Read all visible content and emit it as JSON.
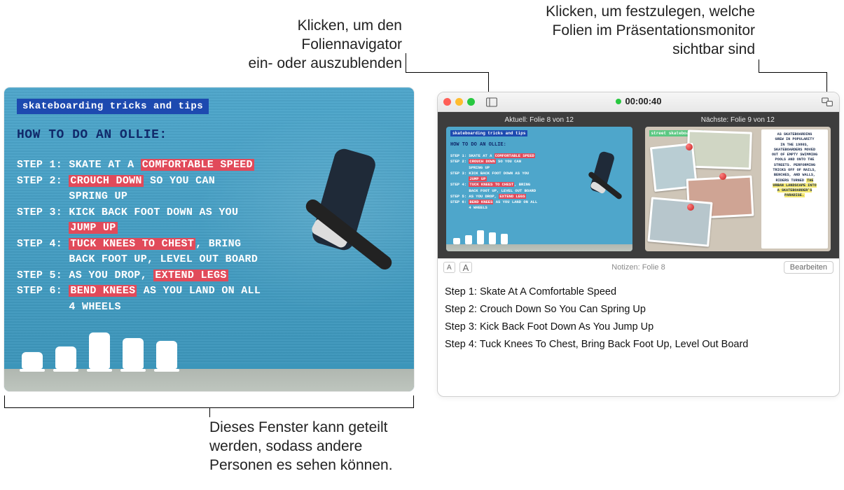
{
  "callouts": {
    "navigator": "Klicken, um den Foliennavigator\nein- oder auszublenden",
    "visibleSlides": "Klicken, um festzulegen, welche\nFolien im Präsentationsmonitor\nsichtbar sind",
    "shareWindow": "Dieses Fenster kann geteilt\nwerden, sodass andere\nPersonen es sehen können."
  },
  "mainSlide": {
    "pill": "skateboarding tricks and tips",
    "heading": "HOW TO DO AN OLLIE:",
    "steps_html": "STEP 1: SKATE AT A <span class='hl'>COMFORTABLE SPEED</span><br>STEP 2: <span class='hl'>CROUCH DOWN</span> SO YOU CAN<br>&nbsp;&nbsp;&nbsp;&nbsp;&nbsp;&nbsp;&nbsp;&nbsp;SPRING UP<br>STEP 3: KICK BACK FOOT DOWN AS YOU<br>&nbsp;&nbsp;&nbsp;&nbsp;&nbsp;&nbsp;&nbsp;&nbsp;<span class='hl'>JUMP UP</span><br>STEP 4: <span class='hl'>TUCK KNEES TO CHEST</span>, BRING<br>&nbsp;&nbsp;&nbsp;&nbsp;&nbsp;&nbsp;&nbsp;&nbsp;BACK FOOT UP, LEVEL OUT BOARD<br>STEP 5: AS YOU DROP, <span class='hl'>EXTEND LEGS</span><br>STEP 6: <span class='hl'>BEND KNEES</span> AS YOU LAND ON ALL<br>&nbsp;&nbsp;&nbsp;&nbsp;&nbsp;&nbsp;&nbsp;&nbsp;4 WHEELS"
  },
  "presenter": {
    "timer": "00:00:40",
    "currentLabel": "Aktuell: Folie 8 von 12",
    "nextLabel": "Nächste: Folie 9 von 12",
    "notesCaption": "Notizen: Folie 8",
    "editLabel": "Bearbeiten",
    "mini1": {
      "pill": "skateboarding tricks and tips",
      "heading": "HOW TO DO AN OLLIE:",
      "steps_html": "STEP 1: SKATE AT A <span class='hl'>COMFORTABLE SPEED</span><br>STEP 2: <span class='hl'>CROUCH DOWN</span> SO YOU CAN<br>&nbsp;&nbsp;&nbsp;&nbsp;&nbsp;&nbsp;&nbsp;&nbsp;SPRING UP<br>STEP 3: KICK BACK FOOT DOWN AS YOU<br>&nbsp;&nbsp;&nbsp;&nbsp;&nbsp;&nbsp;&nbsp;&nbsp;<span class='hl'>JUMP UP</span><br>STEP 4: <span class='hl'>TUCK KNEES TO CHEST</span>, BRING<br>&nbsp;&nbsp;&nbsp;&nbsp;&nbsp;&nbsp;&nbsp;&nbsp;BACK FOOT UP, LEVEL OUT BOARD<br>STEP 5: AS YOU DROP, <span class='hl'>EXTEND LEGS</span><br>STEP 6: <span class='hl'>BEND KNEES</span> AS YOU LAND ON ALL<br>&nbsp;&nbsp;&nbsp;&nbsp;&nbsp;&nbsp;&nbsp;&nbsp;4 WHEELS"
    },
    "mini2": {
      "pill": "street skateboarding",
      "sidetext_html": "AS SKATEBOARDING<br>GREW IN POPULARITY<br>IN THE 1980S,<br>SKATEBOARDERS MOVED<br>OUT OF EMPTY SWIMMING<br>POOLS AND ONTO THE<br>STREETS. PERFORMING<br>TRICKS OFF OF RAILS,<br>BENCHES, AND WALLS,<br>RIDERS TURNED <span class='y'>THE<br>URBAN LANDSCAPE INTO<br>A SKATEBOARDER'S<br>PARADISE.</span>"
    },
    "notes": [
      "Step 1: Skate At A Comfortable Speed",
      "Step 2: Crouch Down So You Can Spring Up",
      "Step 3: Kick Back Foot Down As You Jump Up",
      "Step 4: Tuck Knees To Chest, Bring Back Foot Up, Level Out Board"
    ]
  }
}
